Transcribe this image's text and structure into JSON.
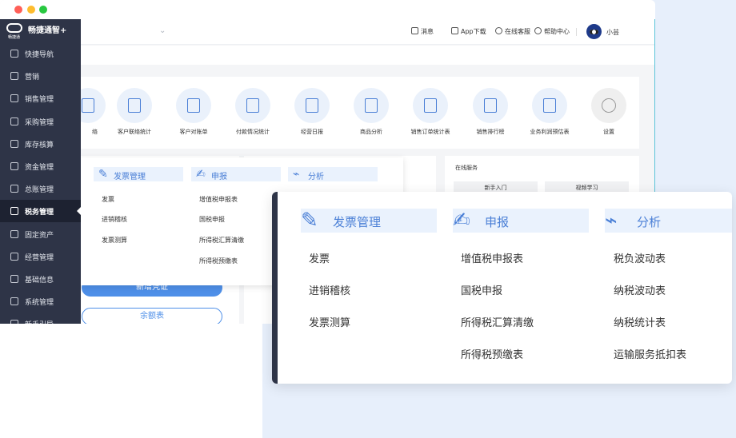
{
  "app": {
    "name": "畅捷通智+",
    "logo_sub": "畅捷通"
  },
  "topbar": {
    "messages": "消息",
    "app_download": "App下载",
    "support": "在线客服",
    "help": "帮助中心",
    "username": "小芸"
  },
  "sidebar": {
    "items": [
      {
        "label": "快捷导航",
        "icon": "compass-icon"
      },
      {
        "label": "营销",
        "icon": "gift-icon"
      },
      {
        "label": "销售管理",
        "icon": "tag-icon"
      },
      {
        "label": "采购管理",
        "icon": "bag-icon"
      },
      {
        "label": "库存核算",
        "icon": "warehouse-icon"
      },
      {
        "label": "资金管理",
        "icon": "money-bag-icon"
      },
      {
        "label": "总账管理",
        "icon": "ledger-icon"
      },
      {
        "label": "税务管理",
        "icon": "tax-icon",
        "active": true
      },
      {
        "label": "固定资产",
        "icon": "asset-icon"
      },
      {
        "label": "经营管理",
        "icon": "clipboard-icon"
      },
      {
        "label": "基础信息",
        "icon": "info-card-icon"
      },
      {
        "label": "系统管理",
        "icon": "loading-icon"
      },
      {
        "label": "新手引导",
        "icon": "guide-icon"
      }
    ]
  },
  "features": [
    {
      "label": "络",
      "icon": "partial-icon"
    },
    {
      "label": "客户联络统计",
      "icon": "contact-stats-icon"
    },
    {
      "label": "客户对账单",
      "icon": "statement-icon"
    },
    {
      "label": "付款情况统计",
      "icon": "payment-stats-icon"
    },
    {
      "label": "经营日报",
      "icon": "daily-report-icon"
    },
    {
      "label": "商品分析",
      "icon": "chart-line-icon"
    },
    {
      "label": "销售订单统计表",
      "icon": "order-stats-icon"
    },
    {
      "label": "销售排行榜",
      "icon": "ranking-icon"
    },
    {
      "label": "业务利润预估表",
      "icon": "profit-icon"
    },
    {
      "label": "设置",
      "icon": "gear-icon"
    }
  ],
  "buttons": {
    "new_voucher": "新增凭证",
    "balance_table": "余额表"
  },
  "service": {
    "title": "在线服务",
    "btn1": "新手入门",
    "btn2": "视频学习"
  },
  "tax_menu": {
    "groups": [
      {
        "title": "发票管理",
        "items": [
          "发票",
          "进销稽核",
          "发票测算"
        ]
      },
      {
        "title": "申报",
        "items": [
          "增值税申报表",
          "国税申报",
          "所得税汇算清缴",
          "所得税预缴表"
        ]
      },
      {
        "title": "分析",
        "items": [
          "税负波动表",
          "纳税波动表",
          "纳税统计表",
          "运输服务抵扣表"
        ]
      }
    ]
  }
}
